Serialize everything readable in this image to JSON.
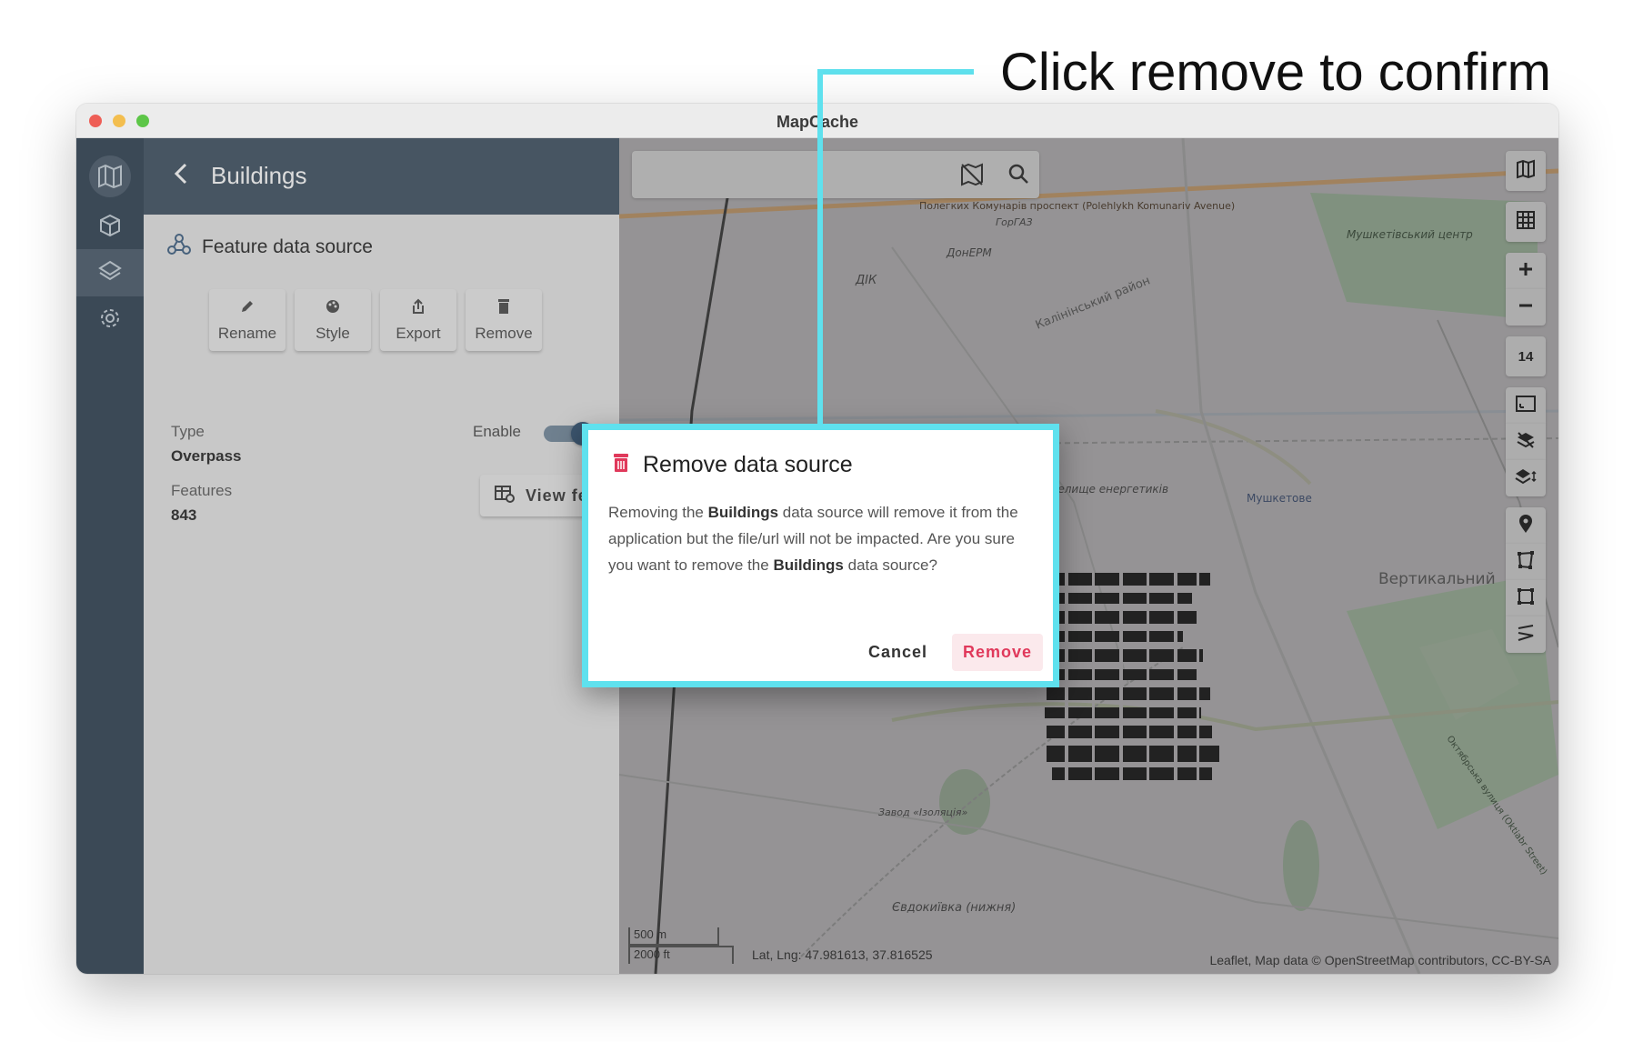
{
  "annotation": {
    "text": "Click remove to confirm"
  },
  "window": {
    "title": "MapCache"
  },
  "rail": {
    "items": [
      "logo-icon",
      "cube-icon",
      "layers-icon",
      "gear-icon"
    ],
    "active": "layers-icon"
  },
  "panel": {
    "title": "Buildings",
    "data_source_label": "Feature data source",
    "actions": [
      {
        "label": "Rename",
        "icon": "pencil-icon"
      },
      {
        "label": "Style",
        "icon": "palette-icon"
      },
      {
        "label": "Export",
        "icon": "export-icon"
      },
      {
        "label": "Remove",
        "icon": "trash-icon"
      }
    ],
    "type_label": "Type",
    "type_value": "Overpass",
    "enable_label": "Enable",
    "enabled": true,
    "features_label": "Features",
    "features_value": "843",
    "view_features_label": "View features"
  },
  "map": {
    "zoom_level": "14",
    "scale_metric": "500 m",
    "scale_imperial": "2000 ft",
    "latlng": "Lat, Lng: 47.981613, 37.816525",
    "attribution": "Leaflet, Map data © OpenStreetMap contributors, CC-BY-SA",
    "labels": {
      "street_top": "Полегких Комунарів проспект (Polehlykh Komunariv Avenue)",
      "dark": "ДонЕРМ",
      "gorgaz": "ГорГАЗ",
      "dik": "ДІК",
      "kalinin": "Калінінський район",
      "center": "Мушкетівський центр",
      "mushketove": "Мушкетове",
      "vertykalnyi": "Вертикальний",
      "selyshche": "Селище енергетиків",
      "zavod": "Завод «Ізоляція»",
      "yevdokivka": "Євдокиївка (нижня)",
      "okruzhna": "Октябрська вулиця (Oktiabr Street)"
    }
  },
  "dialog": {
    "title": "Remove data source",
    "body_1": "Removing the ",
    "body_name_1": "Buildings",
    "body_2": " data source will remove it from the application but the file/url will not be impacted. Are you sure you want to remove the ",
    "body_name_2": "Buildings",
    "body_3": " data source?",
    "cancel_label": "Cancel",
    "remove_label": "Remove"
  },
  "colors": {
    "accent_cyan": "#5fe1ee",
    "danger": "#e0395b",
    "sidebar": "#3b4c5c",
    "header": "#4a5b6b"
  }
}
